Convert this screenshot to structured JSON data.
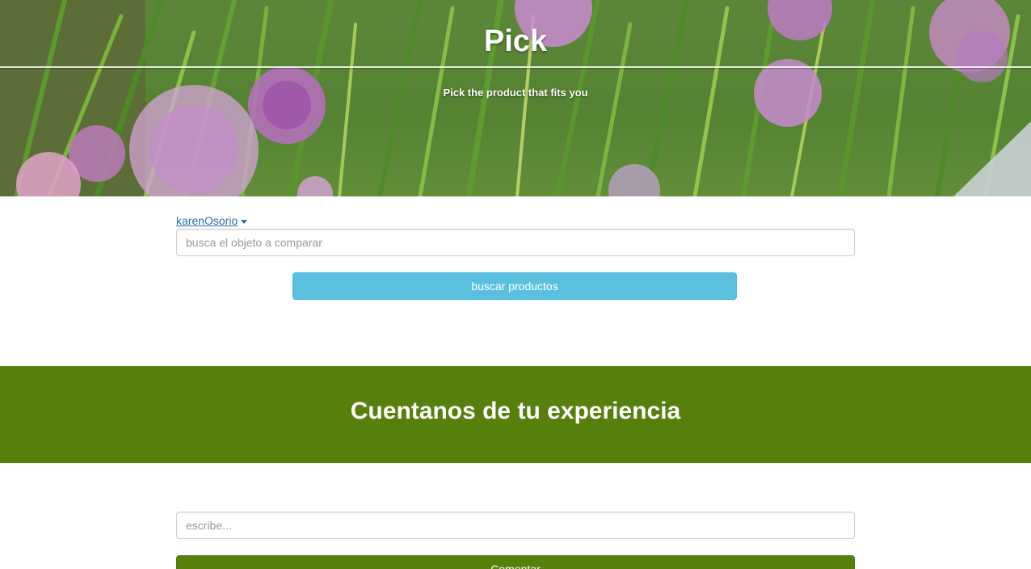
{
  "hero": {
    "title": "Pick",
    "subtitle": "Pick the product that fits you",
    "background_image": "chive-flowers-photo"
  },
  "user_menu": {
    "username": "karenOsorio",
    "icon": "caret-down-icon"
  },
  "search": {
    "placeholder": "busca el objeto a comparar",
    "value": "",
    "button_label": "buscar productos",
    "button_color": "#5bc0de"
  },
  "experience": {
    "heading": "Cuentanos de tu experiencia",
    "background_color": "#567f0b",
    "comment_placeholder": "escribe...",
    "comment_value": "",
    "submit_label": "Comentar"
  }
}
